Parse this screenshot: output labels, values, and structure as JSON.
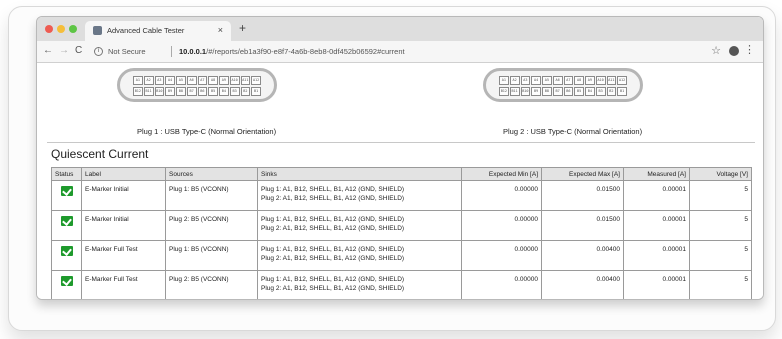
{
  "browser": {
    "tab_title": "Advanced Cable Tester",
    "tab_close": "×",
    "new_tab": "+",
    "nav_back": "←",
    "nav_forward": "→",
    "nav_reload": "C",
    "not_secure": "Not Secure",
    "url_host": "10.0.0.1",
    "url_path": "/#/reports/eb1a3f90-e8f7-4a6b-8eb8-0df452b06592#current",
    "bookmark_icon": "star-icon",
    "menu_icon": "⋮"
  },
  "plugs": [
    {
      "caption": "Plug 1 : USB Type-C (Normal Orientation)",
      "top_pins": [
        "A1",
        "A2",
        "A3",
        "A4",
        "A5",
        "A6",
        "A7",
        "A8",
        "A9",
        "A10",
        "A11",
        "A12"
      ],
      "bottom_pins": [
        "B12",
        "B11",
        "B10",
        "B9",
        "B8",
        "B7",
        "B6",
        "B5",
        "B4",
        "B3",
        "B2",
        "B1"
      ]
    },
    {
      "caption": "Plug 2 : USB Type-C (Normal Orientation)",
      "top_pins": [
        "A1",
        "A2",
        "A3",
        "A4",
        "A5",
        "A6",
        "A7",
        "A8",
        "A9",
        "A10",
        "A11",
        "A12"
      ],
      "bottom_pins": [
        "B12",
        "B11",
        "B10",
        "B9",
        "B8",
        "B7",
        "B6",
        "B5",
        "B4",
        "B3",
        "B2",
        "B1"
      ]
    }
  ],
  "section": {
    "title": "Quiescent Current"
  },
  "table": {
    "headers": {
      "status": "Status",
      "label": "Label",
      "sources": "Sources",
      "sinks": "Sinks",
      "expected_min": "Expected Min [A]",
      "expected_max": "Expected Max [A]",
      "measured": "Measured [A]",
      "voltage": "Voltage [V]"
    },
    "rows": [
      {
        "status": "pass",
        "label": "E-Marker Initial",
        "sources": "Plug 1: B5 (VCONN)",
        "sinks": [
          "Plug 1: A1, B12, SHELL, B1, A12 (GND, SHIELD)",
          "Plug 2: A1, B12, SHELL, B1, A12 (GND, SHIELD)"
        ],
        "expected_min": "0.00000",
        "expected_max": "0.01500",
        "measured": "0.00001",
        "voltage": "5"
      },
      {
        "status": "pass",
        "label": "E-Marker Initial",
        "sources": "Plug 2: B5 (VCONN)",
        "sinks": [
          "Plug 1: A1, B12, SHELL, B1, A12 (GND, SHIELD)",
          "Plug 2: A1, B12, SHELL, B1, A12 (GND, SHIELD)"
        ],
        "expected_min": "0.00000",
        "expected_max": "0.01500",
        "measured": "0.00001",
        "voltage": "5"
      },
      {
        "status": "pass",
        "label": "E-Marker Full Test",
        "sources": "Plug 1: B5 (VCONN)",
        "sinks": [
          "Plug 1: A1, B12, SHELL, B1, A12 (GND, SHIELD)",
          "Plug 2: A1, B12, SHELL, B1, A12 (GND, SHIELD)"
        ],
        "expected_min": "0.00000",
        "expected_max": "0.00400",
        "measured": "0.00001",
        "voltage": "5"
      },
      {
        "status": "pass",
        "label": "E-Marker Full Test",
        "sources": "Plug 2: B5 (VCONN)",
        "sinks": [
          "Plug 1: A1, B12, SHELL, B1, A12 (GND, SHIELD)",
          "Plug 2: A1, B12, SHELL, B1, A12 (GND, SHIELD)"
        ],
        "expected_min": "0.00000",
        "expected_max": "0.00400",
        "measured": "0.00001",
        "voltage": "5"
      }
    ]
  },
  "colors": {
    "pass": "#1e9a2c",
    "header_bg": "#e3e3e3"
  }
}
